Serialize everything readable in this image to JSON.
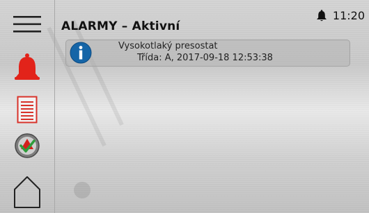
{
  "status": {
    "time": "11:20",
    "bell_icon": "bell-icon"
  },
  "header": {
    "title": "ALARMY – Aktivní"
  },
  "alarms": [
    {
      "icon": "info-icon",
      "name": "Vysokotlaký presostat",
      "detail": "Třída: A, 2017-09-18 12:53:38"
    }
  ],
  "sidebar": {
    "items": [
      {
        "icon": "menu-icon"
      },
      {
        "icon": "alarm-bell-icon",
        "color": "#e2231a"
      },
      {
        "icon": "list-icon",
        "color": "#d8322a"
      },
      {
        "icon": "acknowledge-check-icon"
      },
      {
        "icon": "home-icon"
      }
    ]
  },
  "colors": {
    "accent_red": "#e2231a",
    "info_blue": "#1565a7"
  }
}
